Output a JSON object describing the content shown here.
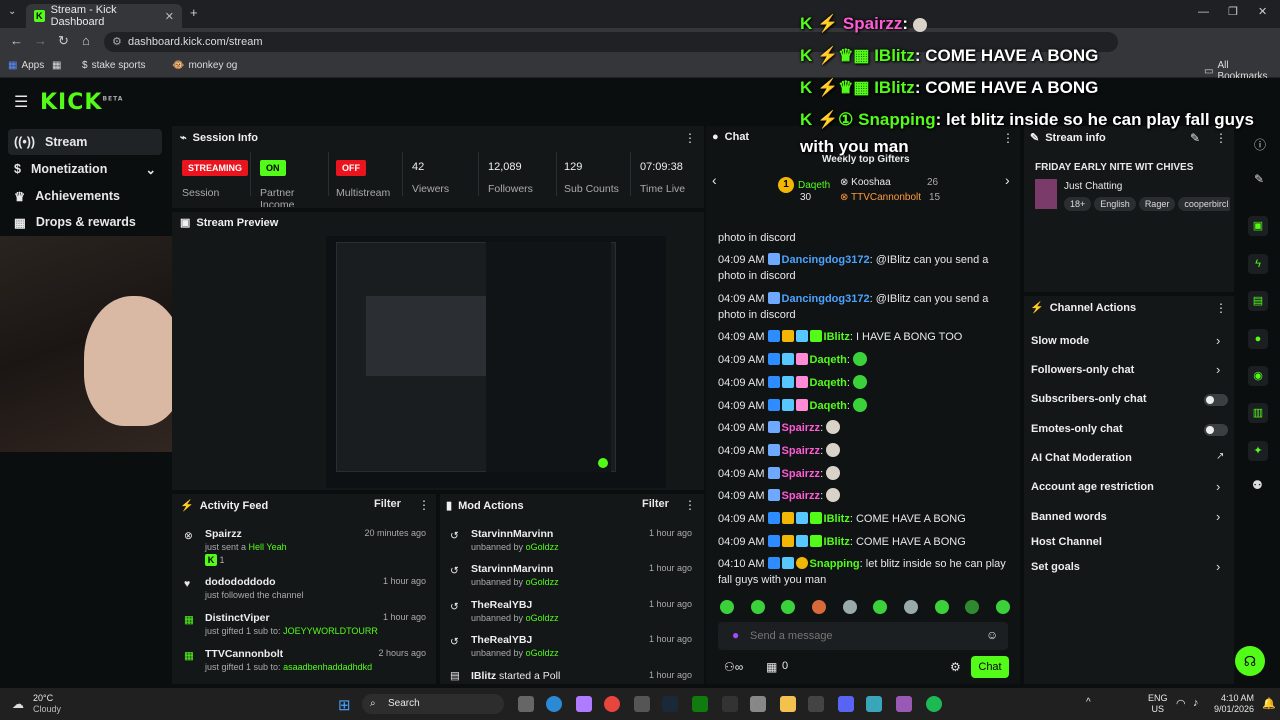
{
  "browser": {
    "tab_title": "Stream - Kick Dashboard",
    "url": "dashboard.kick.com/stream",
    "bookmarks": [
      "Apps",
      "stake sports",
      "monkey og"
    ],
    "all_bookmarks": "All Bookmarks"
  },
  "brand": {
    "logo": "KICK",
    "beta": "BETA"
  },
  "sidebar": {
    "items": [
      {
        "label": "Stream",
        "icon": "stream-icon"
      },
      {
        "label": "Monetization",
        "icon": "dollar-icon"
      },
      {
        "label": "Achievements",
        "icon": "trophy-icon"
      },
      {
        "label": "Drops & rewards",
        "icon": "gift-icon"
      }
    ]
  },
  "session": {
    "title": "Session Info",
    "stats": [
      {
        "badge": "STREAMING",
        "label": "Session",
        "color": "#e9141d"
      },
      {
        "badge": "ON",
        "label": "Partner Income",
        "color": "#53fc18"
      },
      {
        "badge": "OFF",
        "label": "Multistream",
        "color": "#e9141d"
      },
      {
        "value": "42",
        "label": "Viewers"
      },
      {
        "value": "12,089",
        "label": "Followers"
      },
      {
        "value": "129",
        "label": "Sub Counts"
      },
      {
        "value": "07:09:38",
        "label": "Time Live"
      }
    ]
  },
  "preview": {
    "title": "Stream Preview"
  },
  "activity": {
    "title": "Activity Feed",
    "filter": "Filter",
    "items": [
      {
        "name": "Spairzz",
        "sub": "just sent a",
        "gift": "Hell Yeah",
        "extra": "1",
        "time": "20 minutes ago"
      },
      {
        "name": "dodododdodo",
        "sub": "just followed the channel",
        "time": "1 hour ago"
      },
      {
        "name": "DistinctViper",
        "sub": "just gifted 1 sub to:",
        "target": "JOEYYWORLDTOURR",
        "time": "1 hour ago"
      },
      {
        "name": "TTVCannonbolt",
        "sub": "just gifted 1 sub to:",
        "target": "asaadbenhaddadhdkd",
        "time": "2 hours ago"
      }
    ]
  },
  "mod": {
    "title": "Mod Actions",
    "filter": "Filter",
    "items": [
      {
        "name": "StarvinnMarvinn",
        "action": "unbanned by",
        "by": "oGoldzz",
        "time": "1 hour ago"
      },
      {
        "name": "StarvinnMarvinn",
        "action": "unbanned by",
        "by": "oGoldzz",
        "time": "1 hour ago"
      },
      {
        "name": "TheRealYBJ",
        "action": "unbanned by",
        "by": "oGoldzz",
        "time": "1 hour ago"
      },
      {
        "name": "TheRealYBJ",
        "action": "unbanned by",
        "by": "oGoldzz",
        "time": "1 hour ago"
      },
      {
        "name": "IBlitz",
        "action": "started a Poll",
        "time": "1 hour ago"
      }
    ]
  },
  "chat": {
    "title": "Chat",
    "gifters_title": "Weekly top Gifters",
    "gifters": [
      {
        "name": "Daqeth",
        "count": "30"
      },
      {
        "name": "Kooshaa",
        "count": "26"
      },
      {
        "name": "TTVCannonbolt",
        "count": "15"
      }
    ],
    "messages": [
      {
        "time": "",
        "user": "",
        "text": "photo in discord",
        "partial": true
      },
      {
        "time": "04:09 AM",
        "user": "Dancingdog3172",
        "text": ": @IBlitz can you send a photo in discord",
        "color": "#4aa3ff"
      },
      {
        "time": "04:09 AM",
        "user": "Dancingdog3172",
        "text": ": @IBlitz can you send a photo in discord",
        "color": "#4aa3ff"
      },
      {
        "time": "04:09 AM",
        "user": "IBlitz",
        "text": ": I HAVE A BONG TOO",
        "color": "#53fc18"
      },
      {
        "time": "04:09 AM",
        "user": "Daqeth",
        "text": ":",
        "color": "#53fc18",
        "emote": true
      },
      {
        "time": "04:09 AM",
        "user": "Daqeth",
        "text": ":",
        "color": "#53fc18",
        "emote": true
      },
      {
        "time": "04:09 AM",
        "user": "Daqeth",
        "text": ":",
        "color": "#53fc18",
        "emote": true
      },
      {
        "time": "04:09 AM",
        "user": "Spairzz",
        "text": ":",
        "color": "#ff5bd6",
        "skull": true
      },
      {
        "time": "04:09 AM",
        "user": "Spairzz",
        "text": ":",
        "color": "#ff5bd6",
        "skull": true
      },
      {
        "time": "04:09 AM",
        "user": "Spairzz",
        "text": ":",
        "color": "#ff5bd6",
        "skull": true
      },
      {
        "time": "04:09 AM",
        "user": "Spairzz",
        "text": ":",
        "color": "#ff5bd6",
        "skull": true
      },
      {
        "time": "04:09 AM",
        "user": "IBlitz",
        "text": ": COME HAVE A BONG",
        "color": "#53fc18"
      },
      {
        "time": "04:09 AM",
        "user": "IBlitz",
        "text": ": COME HAVE A BONG",
        "color": "#53fc18"
      },
      {
        "time": "04:10 AM",
        "user": "Snapping",
        "text": ": let blitz inside so he can play fall guys with you man",
        "color": "#53fc18"
      }
    ],
    "placeholder": "Send a message",
    "send": "Chat",
    "count": "0"
  },
  "overlay": [
    {
      "user": "Spairzz",
      "text": ":",
      "color": "#ff5bd6"
    },
    {
      "user": "IBlitz",
      "text": ": COME HAVE A BONG",
      "color": "#53fc18"
    },
    {
      "user": "IBlitz",
      "text": ": COME HAVE A BONG",
      "color": "#53fc18"
    },
    {
      "user": "Snapping",
      "text": ": let blitz inside so he can play fall guys",
      "color": "#53fc18"
    },
    {
      "user": "",
      "text": "with you man",
      "color": "#ffffff"
    }
  ],
  "stream_info": {
    "title": "Stream info",
    "stream_title": "FRIDAY EARLY NITE WIT CHIVES",
    "category": "Just Chatting",
    "tags": [
      "18+",
      "English",
      "Rager",
      "cooperbircl"
    ]
  },
  "channel_actions": {
    "title": "Channel Actions",
    "items": [
      {
        "label": "Slow mode",
        "control": "chevron"
      },
      {
        "label": "Followers-only chat",
        "control": "chevron"
      },
      {
        "label": "Subscribers-only chat",
        "control": "toggle"
      },
      {
        "label": "Emotes-only chat",
        "control": "toggle"
      },
      {
        "label": "AI Chat Moderation",
        "control": "external"
      },
      {
        "label": "Account age restriction",
        "control": "chevron"
      },
      {
        "label": "Banned words",
        "control": "chevron"
      },
      {
        "label": "Host Channel",
        "control": "none"
      },
      {
        "label": "Set goals",
        "control": "chevron"
      }
    ]
  },
  "taskbar": {
    "weather_temp": "20°C",
    "weather_desc": "Cloudy",
    "search": "Search",
    "lang": "ENG",
    "region": "US",
    "time": "4:10 AM",
    "date": "9/01/2026"
  }
}
